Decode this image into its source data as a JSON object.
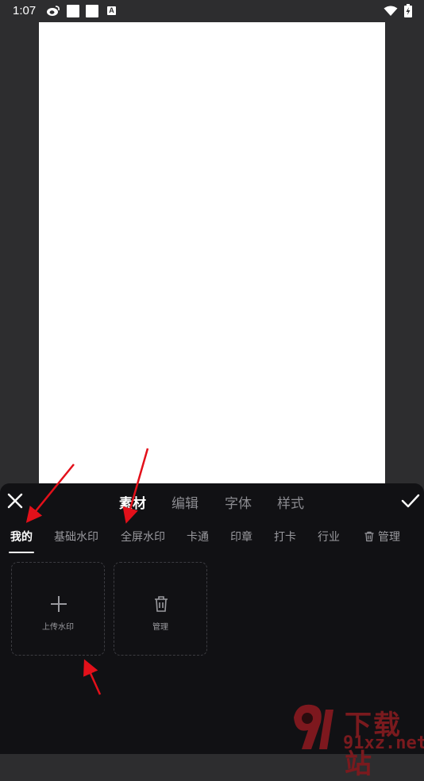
{
  "status_bar": {
    "time": "1:07",
    "icons": [
      "weibo-icon",
      "square-icon",
      "square-icon",
      "a-notification-icon",
      "wifi-icon",
      "battery-charging-icon"
    ]
  },
  "header_tabs": [
    {
      "label": "素材",
      "active": true
    },
    {
      "label": "编辑",
      "active": false
    },
    {
      "label": "字体",
      "active": false
    },
    {
      "label": "样式",
      "active": false
    }
  ],
  "categories": [
    {
      "label": "我的",
      "active": true
    },
    {
      "label": "基础水印",
      "active": false
    },
    {
      "label": "全屏水印",
      "active": false
    },
    {
      "label": "卡通",
      "active": false
    },
    {
      "label": "印章",
      "active": false
    },
    {
      "label": "打卡",
      "active": false
    },
    {
      "label": "行业",
      "active": false
    }
  ],
  "manage_tab_label": "管理",
  "tiles": {
    "upload_label": "上传水印",
    "manage_label": "管理"
  },
  "watermark": {
    "top_text": "下载站",
    "bottom_text": "91xz.net"
  },
  "colors": {
    "panel_bg": "#111114",
    "backdrop": "#2d2d2f",
    "arrow_red": "#e3101a"
  }
}
